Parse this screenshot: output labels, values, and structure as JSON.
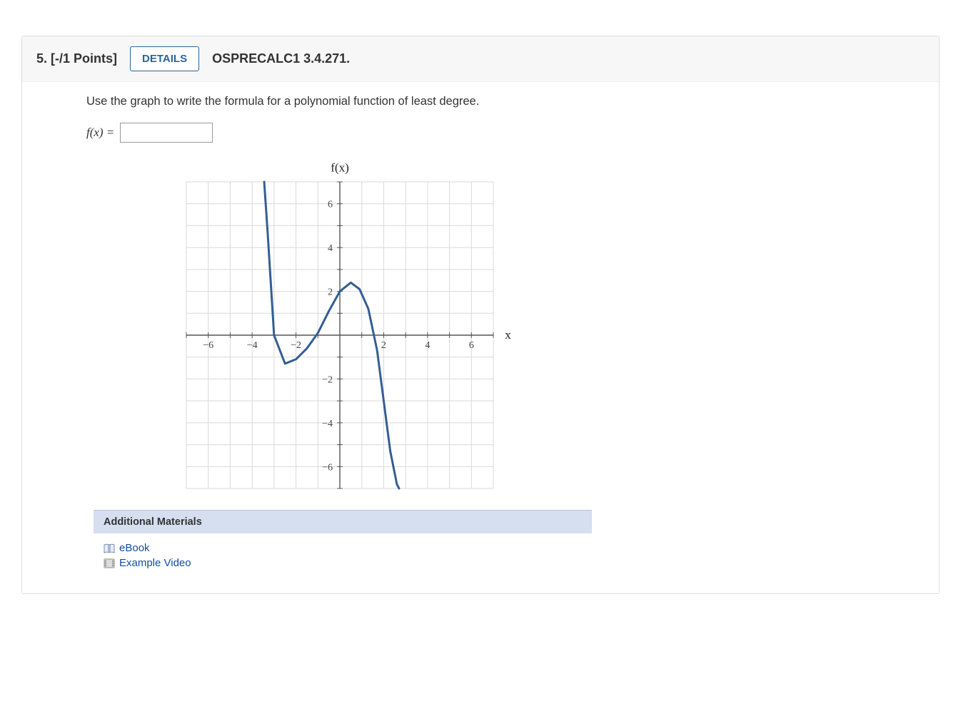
{
  "header": {
    "question_number": "5.",
    "points": "[-/1 Points]",
    "details_label": "DETAILS",
    "location": "OSPRECALC1 3.4.271."
  },
  "prompt": "Use the graph to write the formula for a polynomial function of least degree.",
  "answer": {
    "label": "f(x) =",
    "value": ""
  },
  "materials": {
    "heading": "Additional Materials",
    "links": [
      {
        "label": "eBook",
        "icon": "book-icon"
      },
      {
        "label": "Example Video",
        "icon": "film-icon"
      }
    ]
  },
  "chart_data": {
    "type": "line",
    "title": "f(x)",
    "xlabel": "x",
    "ylabel": "",
    "xlim": [
      -7,
      7
    ],
    "ylim": [
      -7,
      7
    ],
    "x_ticks": [
      -6,
      -4,
      -2,
      2,
      4,
      6
    ],
    "y_ticks": [
      -6,
      -4,
      -2,
      2,
      4,
      6
    ],
    "grid": true,
    "series": [
      {
        "name": "f(x)",
        "x": [
          -3.45,
          -3.3,
          -3,
          -2.5,
          -2,
          -1.5,
          -1,
          -0.5,
          0,
          0.5,
          0.9,
          1.3,
          1.7,
          2,
          2.3,
          2.6,
          2.7
        ],
        "y": [
          7,
          4.8,
          0,
          -1.3,
          -1.1,
          -0.6,
          0.1,
          1.1,
          2,
          2.4,
          2.1,
          1.2,
          -0.7,
          -3,
          -5.3,
          -6.8,
          -7
        ]
      }
    ],
    "annotations": [
      {
        "text": "f(x)",
        "x": 0,
        "y": 7.4
      },
      {
        "text": "x",
        "x": 7.4,
        "y": 0
      }
    ]
  }
}
